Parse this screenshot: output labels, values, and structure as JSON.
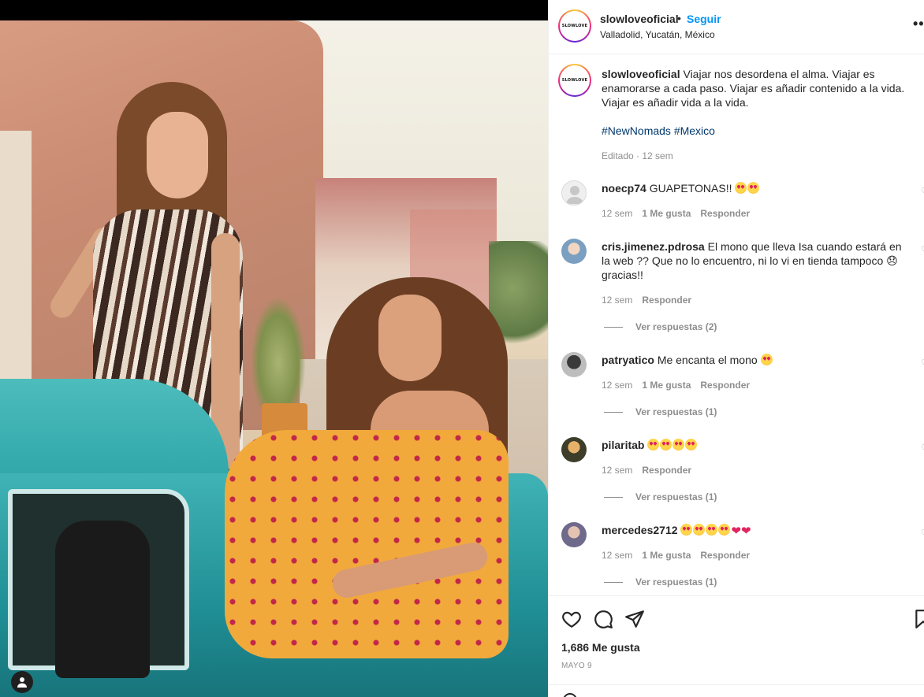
{
  "post": {
    "author": "slowloveoficial",
    "logo_text": "SLOWLOVE",
    "follow_label": "Seguir",
    "dot": "•",
    "location": "Valladolid, Yucatán, México",
    "more_label": "•••",
    "caption_text": "Viajar nos desordena el alma. Viajar es enamorarse a cada paso. Viajar es añadir contenido a la vida. Viajar es añadir vida a la vida.",
    "hashtags": "#NewNomads #Mexico",
    "caption_meta": "Editado · 12 sem"
  },
  "comments": [
    {
      "user": "noecp74",
      "text": "GUAPETONAS!!",
      "emoji_count": 2,
      "hearts": 0,
      "time": "12 sem",
      "likes": "1 Me gusta",
      "reply": "Responder",
      "replies": ""
    },
    {
      "user": "cris.jimenez.pdrosa",
      "text": "El mono que lleva Isa cuando estará en la web ?? Que no lo encuentro, ni lo vi en tienda tampoco 😞 gracias!!",
      "emoji_count": 0,
      "hearts": 0,
      "time": "12 sem",
      "likes": "",
      "reply": "Responder",
      "replies": "Ver respuestas (2)"
    },
    {
      "user": "patryatico",
      "text": "Me encanta el mono",
      "emoji_count": 1,
      "hearts": 0,
      "time": "12 sem",
      "likes": "1 Me gusta",
      "reply": "Responder",
      "replies": "Ver respuestas (1)"
    },
    {
      "user": "pilaritab",
      "text": "",
      "emoji_count": 4,
      "hearts": 0,
      "time": "12 sem",
      "likes": "",
      "reply": "Responder",
      "replies": "Ver respuestas (1)"
    },
    {
      "user": "mercedes2712",
      "text": "",
      "emoji_count": 4,
      "hearts": 2,
      "time": "12 sem",
      "likes": "1 Me gusta",
      "reply": "Responder",
      "replies": "Ver respuestas (1)"
    }
  ],
  "footer": {
    "likes": "1,686 Me gusta",
    "date": "MAYO 9"
  },
  "colors": {
    "follow": "#0095f6",
    "hashtag": "#00376b",
    "muted": "#8e8e8e"
  },
  "icons": [
    "like-icon",
    "comment-icon",
    "share-icon",
    "save-icon",
    "user-tag-icon",
    "emoji-icon"
  ]
}
